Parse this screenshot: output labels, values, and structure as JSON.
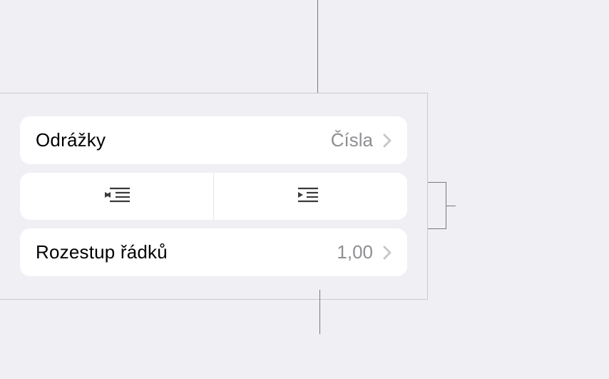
{
  "bullets_row": {
    "label": "Odrážky",
    "value": "Čísla"
  },
  "indent": {
    "outdent_title": "Outdent",
    "indent_title": "Indent"
  },
  "line_spacing": {
    "label": "Rozestup řádků",
    "value": "1,00"
  }
}
